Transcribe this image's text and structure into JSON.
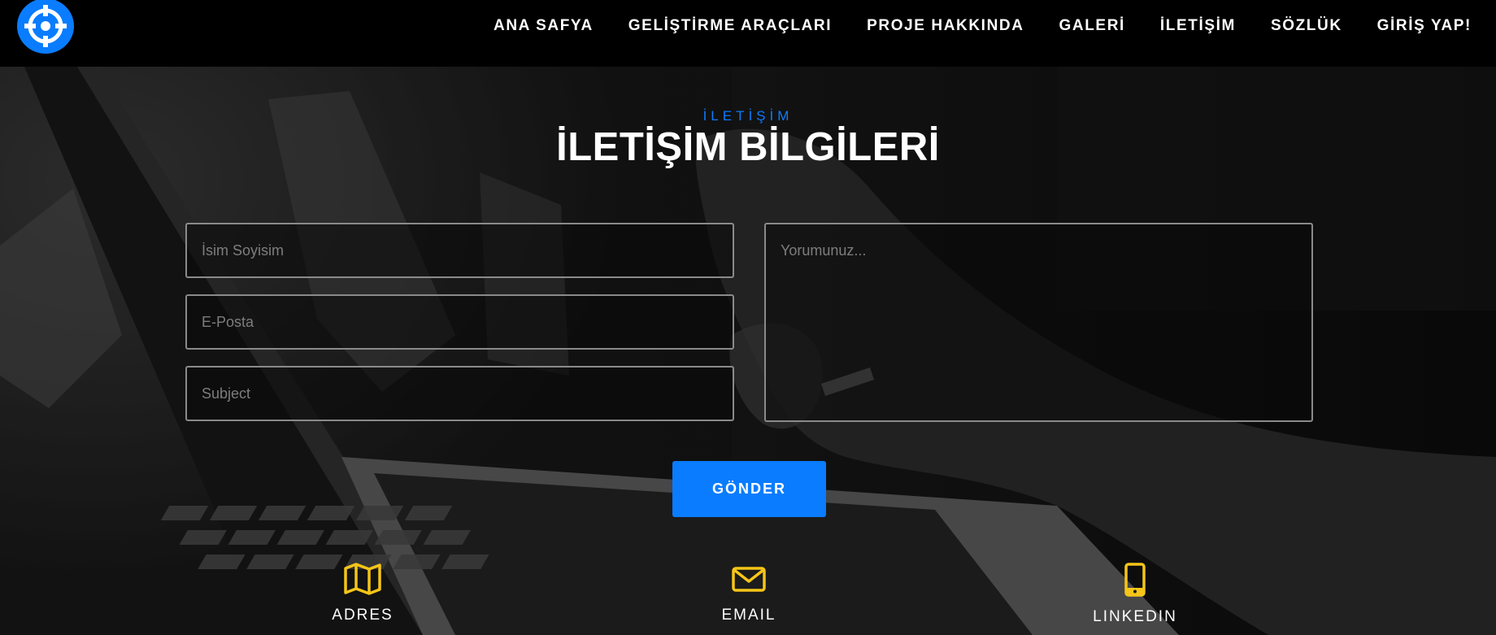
{
  "nav": {
    "logo_icon": "crosshair-icon",
    "items": [
      "ANA SAFYA",
      "GELİŞTİRME ARAÇLARI",
      "PROJE HAKKINDA",
      "GALERİ",
      "İLETİŞİM",
      "SÖZLÜK",
      "GİRİŞ YAP!"
    ]
  },
  "section": {
    "eyebrow": "İLETİŞİM",
    "title": "İLETİŞİM BİLGİLERİ"
  },
  "form": {
    "name_placeholder": "İsim Soyisim",
    "email_placeholder": "E-Posta",
    "subject_placeholder": "Subject",
    "message_placeholder": "Yorumunuz...",
    "submit_label": "GÖNDER"
  },
  "info": [
    {
      "icon": "map-icon",
      "label": "ADRES"
    },
    {
      "icon": "envelope-icon",
      "label": "EMAIL"
    },
    {
      "icon": "phone-icon",
      "label": "LINKEDIN"
    }
  ],
  "colors": {
    "accent": "#0a7cff",
    "icon_yellow": "#f5c518",
    "navbar_bg": "#000000"
  }
}
